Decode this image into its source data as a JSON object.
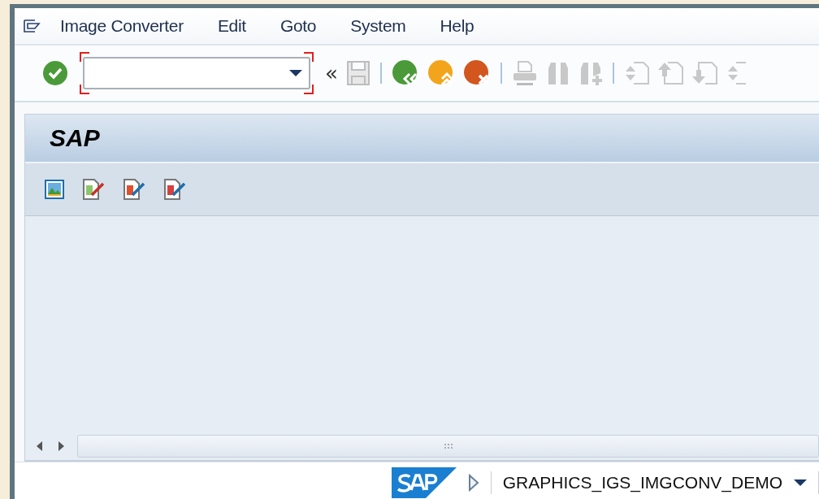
{
  "menu": [
    {
      "label": "Image Converter"
    },
    {
      "label": "Edit"
    },
    {
      "label": "Goto"
    },
    {
      "label": "System"
    },
    {
      "label": "Help"
    }
  ],
  "toolbar": {
    "collapse": "«"
  },
  "title_bar": {
    "title": "SAP"
  },
  "status_bar": {
    "transaction": "GRAPHICS_IGS_IMGCONV_DEMO"
  }
}
